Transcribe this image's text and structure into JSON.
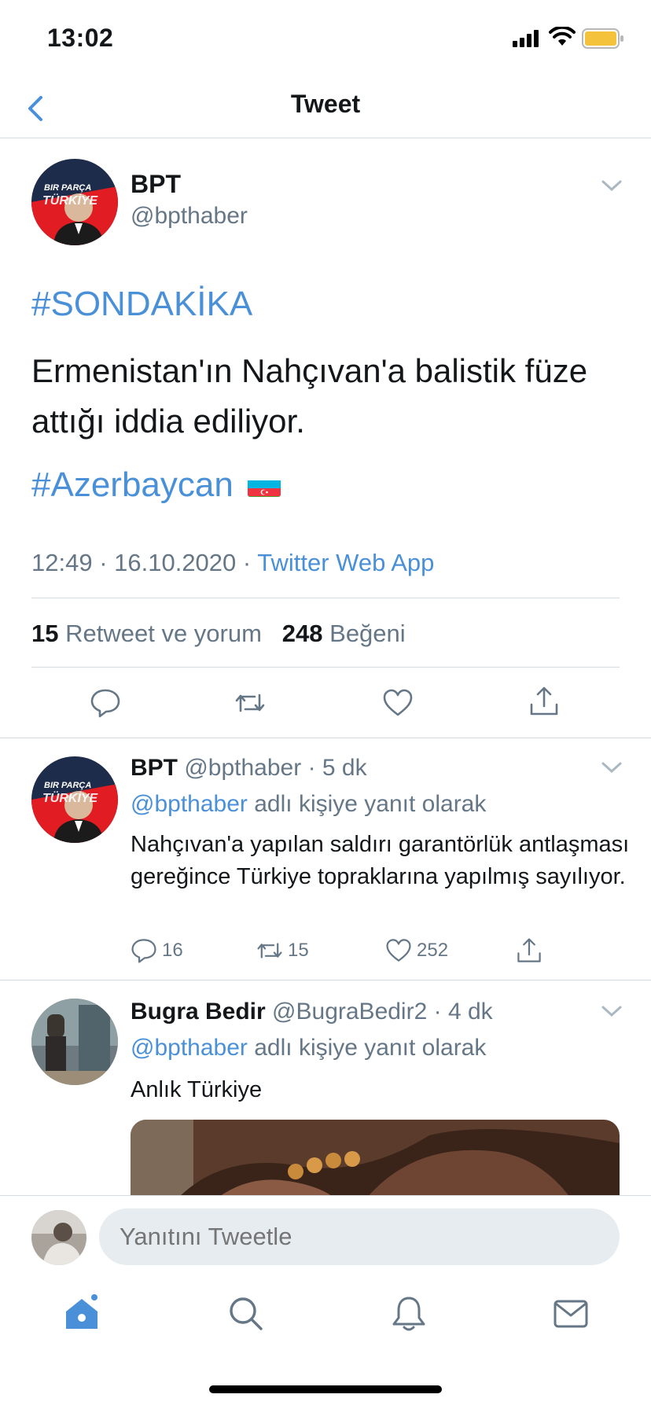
{
  "status_bar": {
    "time": "13:02"
  },
  "nav": {
    "title": "Tweet"
  },
  "main_tweet": {
    "name": "BPT",
    "handle": "@bpthaber",
    "hashtag1": "#SONDAKİKA",
    "text": "Ermenistan'ın Nahçıvan'a balistik füze attığı iddia ediliyor.",
    "hashtag2": "#Azerbaycan",
    "timestamp": "12:49 · 16.10.2020 · ",
    "source": "Twitter Web App",
    "retweets_count": "15",
    "retweets_label": "Retweet ve yorum",
    "likes_count": "248",
    "likes_label": "Beğeni",
    "avatar_text1": "BIR PARÇA",
    "avatar_text2": "TÜRKİYE"
  },
  "replies": [
    {
      "name": "BPT",
      "handle": "@bpthaber",
      "time": "· 5 dk",
      "reply_to_handle": "@bpthaber",
      "reply_to_text": "adlı kişiye yanıt olarak",
      "text": "Nahçıvan'a yapılan saldırı garantörlük antlaşması gereğince Türkiye topraklarına yapılmış sayılıyor.",
      "replies": "16",
      "retweets": "15",
      "likes": "252"
    },
    {
      "name": "Bugra Bedir",
      "handle": "@BugraBedir2",
      "time": "· 4 dk",
      "reply_to_handle": "@bpthaber",
      "reply_to_text": "adlı kişiye yanıt olarak",
      "text": "Anlık Türkiye"
    }
  ],
  "reply_bar": {
    "placeholder": "Yanıtını Tweetle"
  },
  "tabbar": [
    "home-icon",
    "search-icon",
    "bell-icon",
    "mail-icon"
  ],
  "colors": {
    "accent": "#4a90d9",
    "secondary_text": "#657786",
    "divider": "#d6dbe0"
  }
}
